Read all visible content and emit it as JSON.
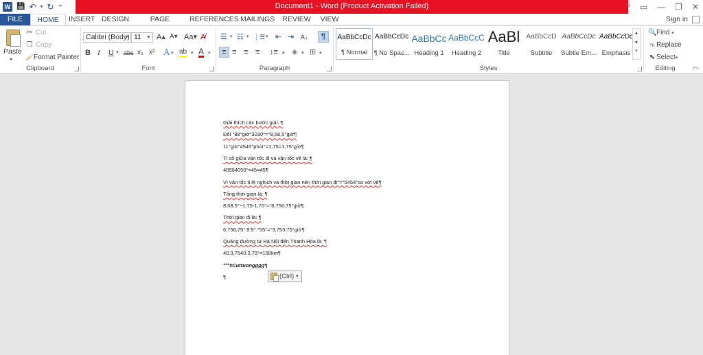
{
  "window": {
    "title": "Document1 - Word (Product Activation Failed)",
    "logo_letter": "W",
    "controls": [
      "?",
      "▭",
      "—",
      "❐",
      "✕"
    ]
  },
  "qat": {
    "save": "💾",
    "undo": "↶",
    "undo_dd": "▾",
    "redo": "↻",
    "customize": "⁼"
  },
  "tabs": [
    "FILE",
    "HOME",
    "INSERT",
    "DESIGN",
    "PAGE LAYOUT",
    "REFERENCES",
    "MAILINGS",
    "REVIEW",
    "VIEW"
  ],
  "signin": "Sign in",
  "clipboard": {
    "label": "Clipboard",
    "paste": "Paste",
    "paste_dd": "▾",
    "cut": "Cut",
    "copy": "Copy",
    "format_painter": "Format Painter"
  },
  "font": {
    "label": "Font",
    "family": "Calibri (Body)",
    "size": "11",
    "grow": "A▴",
    "shrink": "A▾",
    "change_case": "Aa▾",
    "clear": "A̸",
    "bold": "B",
    "italic": "I",
    "underline": "U",
    "strike": "abc",
    "subscript": "x₂",
    "superscript": "x²",
    "effects": "A",
    "highlight": "ab",
    "color": "A"
  },
  "paragraph": {
    "label": "Paragraph",
    "bullets": "☰",
    "numbering": "☷",
    "multilevel": "⋮☰",
    "decrease": "⇤",
    "increase": "⇥",
    "sort": "A↓",
    "show_marks": "¶",
    "align_left": "≡",
    "align_center": "≡",
    "align_right": "≡",
    "justify": "≡",
    "spacing": "↕≡",
    "shading": "◈",
    "borders": "⊞"
  },
  "styles": {
    "label": "Styles",
    "items": [
      {
        "sample": "AaBbCcDc",
        "name": "¶ Normal",
        "size": "10px",
        "color": "#222"
      },
      {
        "sample": "AaBbCcDc",
        "name": "¶ No Spac...",
        "size": "10px",
        "color": "#222"
      },
      {
        "sample": "AaBbCc",
        "name": "Heading 1",
        "size": "14px",
        "color": "#2e74b5"
      },
      {
        "sample": "AaBbCcC",
        "name": "Heading 2",
        "size": "12px",
        "color": "#2e74b5"
      },
      {
        "sample": "AaBl",
        "name": "Title",
        "size": "22px",
        "color": "#222"
      },
      {
        "sample": "AaBbCcD",
        "name": "Subtitle",
        "size": "10px",
        "color": "#666"
      },
      {
        "sample": "AaBbCcDc",
        "name": "Subtle Em...",
        "size": "10px",
        "color": "#555"
      },
      {
        "sample": "AaBbCcDc",
        "name": "Emphasis",
        "size": "10px",
        "color": "#222"
      }
    ]
  },
  "editing": {
    "label": "Editing",
    "find": "Find",
    "replace": "Replace",
    "select": "Select"
  },
  "document": {
    "lines": [
      {
        "text": "Giải thích các bước giải: ¶",
        "style": "squig"
      },
      {
        "text": "Đổi °88°giờ°3030°=°8,58,5°giờ¶",
        "style": "squig"
      },
      {
        "text": "11°giờ°4545°phút°=1,75=1,75°giờ¶",
        "style": "normal"
      },
      {
        "text": "Tỉ số giữa vận tốc đi và vận tốc về là: ¶",
        "style": "squig"
      },
      {
        "text": "40504050°=45=45¶",
        "style": "normal"
      },
      {
        "text": "Vì vận tốc tỉ lệ nghịch và thời gian nên thời gian đi°=°5454°so với về¶",
        "style": "squig"
      },
      {
        "text": "Tổng thời gian là: ¶",
        "style": "squig"
      },
      {
        "text": "8,58,5°−1,75-1,75°=°6,756,75°giờ¶",
        "style": "normal"
      },
      {
        "text": "Thời gian đi là: ¶",
        "style": "squig"
      },
      {
        "text": "6,756,75°:9:9°.°55°=°3,753,75°giờ¶",
        "style": "normal"
      },
      {
        "text": "Quãng đường từ Hà Nội đến Thanh Hóa là: ¶",
        "style": "squig"
      },
      {
        "text": "40.3,7540.3,75°=150km¶",
        "style": "normal"
      },
      {
        "text": "°°°#Cuttuongggg¶",
        "style": "bolditalic"
      },
      {
        "text": "¶",
        "style": "normal"
      }
    ],
    "paste_options": "(Ctrl)",
    "paste_options_dd": "▾"
  }
}
